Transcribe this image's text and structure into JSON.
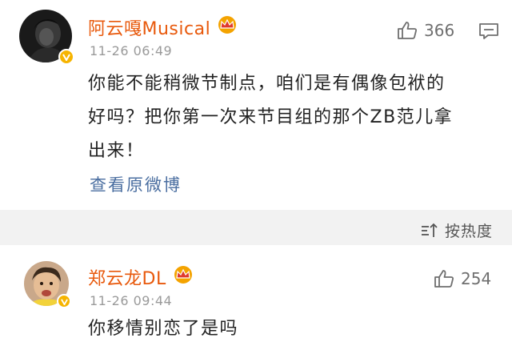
{
  "comments": [
    {
      "username": "阿云嘎Musical",
      "timestamp": "11-26 06:49",
      "likes": "366",
      "text_lines": [
        "你能不能稍微节制点，咱们是有偶像包袱的",
        "好吗？把你第一次来节目组的那个ZB范儿拿",
        "出来！"
      ],
      "view_original_label": "查看原微博",
      "icons": [
        "avatar",
        "verified-badge-icon",
        "crown-icon",
        "thumbs-up-icon",
        "comment-menu-icon"
      ]
    },
    {
      "username": "郑云龙DL",
      "timestamp": "11-26 09:44",
      "likes": "254",
      "text_lines": [
        "你移情别恋了是吗"
      ],
      "icons": [
        "avatar",
        "verified-badge-icon",
        "crown-icon",
        "thumbs-up-icon"
      ]
    }
  ],
  "sort": {
    "label": "按热度",
    "icon": "sort-icon"
  },
  "colors": {
    "username": "#e8590c",
    "link": "#4a6ea0",
    "timestamp": "#9a9a9a",
    "badge": "#f6b400",
    "divider_bg": "#f2f2f2"
  }
}
